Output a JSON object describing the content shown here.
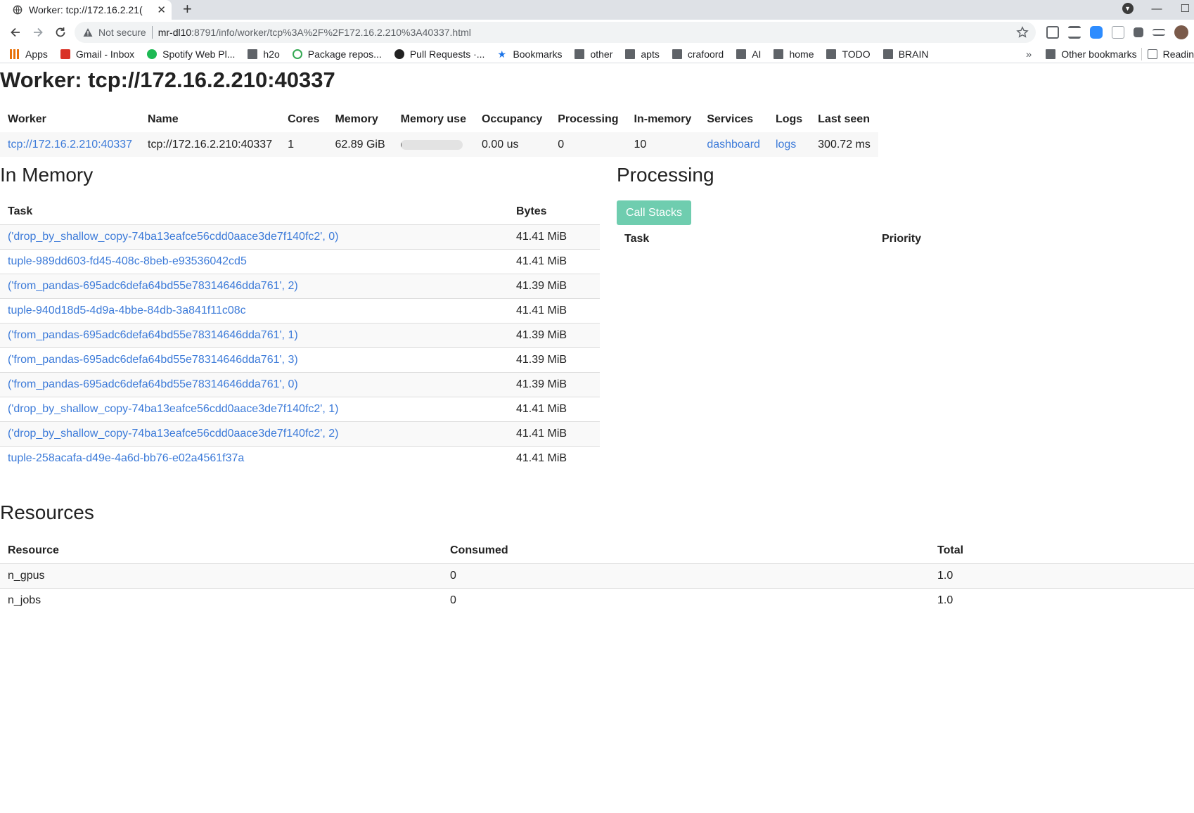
{
  "browser": {
    "tab_title": "Worker: tcp://172.16.2.21(",
    "url_security": "Not secure",
    "url_host": "mr-dl10",
    "url_path": ":8791/info/worker/tcp%3A%2F%2F172.16.2.210%3A40337.html",
    "bookmarks": [
      {
        "label": "Apps",
        "icon": "apps-grid-icon"
      },
      {
        "label": "Gmail - Inbox",
        "icon": "gmail-icon"
      },
      {
        "label": "Spotify Web Pl...",
        "icon": "spotify-icon"
      },
      {
        "label": "h2o",
        "icon": "folder-icon"
      },
      {
        "label": "Package repos...",
        "icon": "loading-ring-icon"
      },
      {
        "label": "Pull Requests ·...",
        "icon": "github-icon"
      },
      {
        "label": "Bookmarks",
        "icon": "star-icon"
      },
      {
        "label": "other",
        "icon": "folder-icon"
      },
      {
        "label": "apts",
        "icon": "folder-icon"
      },
      {
        "label": "crafoord",
        "icon": "folder-icon"
      },
      {
        "label": "AI",
        "icon": "folder-icon"
      },
      {
        "label": "home",
        "icon": "folder-icon"
      },
      {
        "label": "TODO",
        "icon": "folder-icon"
      },
      {
        "label": "BRAIN",
        "icon": "folder-icon"
      }
    ],
    "overflow": "»",
    "other_bookmarks": "Other bookmarks",
    "reading_list": "Readin"
  },
  "page": {
    "title": "Worker: tcp://172.16.2.210:40337"
  },
  "worker_table": {
    "headers": [
      "Worker",
      "Name",
      "Cores",
      "Memory",
      "Memory use",
      "Occupancy",
      "Processing",
      "In-memory",
      "Services",
      "Logs",
      "Last seen"
    ],
    "row": {
      "worker": "tcp://172.16.2.210:40337",
      "name": "tcp://172.16.2.210:40337",
      "cores": "1",
      "memory": "62.89 GiB",
      "memory_use_fraction": 0.02,
      "occupancy": "0.00 us",
      "processing": "0",
      "in_memory": "10",
      "services": "dashboard",
      "logs": "logs",
      "last_seen": "300.72 ms"
    }
  },
  "in_memory": {
    "heading": "In Memory",
    "headers": [
      "Task",
      "Bytes"
    ],
    "rows": [
      {
        "task": "('drop_by_shallow_copy-74ba13eafce56cdd0aace3de7f140fc2', 0)",
        "bytes": "41.41 MiB"
      },
      {
        "task": "tuple-989dd603-fd45-408c-8beb-e93536042cd5",
        "bytes": "41.41 MiB"
      },
      {
        "task": "('from_pandas-695adc6defa64bd55e78314646dda761', 2)",
        "bytes": "41.39 MiB"
      },
      {
        "task": "tuple-940d18d5-4d9a-4bbe-84db-3a841f11c08c",
        "bytes": "41.41 MiB"
      },
      {
        "task": "('from_pandas-695adc6defa64bd55e78314646dda761', 1)",
        "bytes": "41.39 MiB"
      },
      {
        "task": "('from_pandas-695adc6defa64bd55e78314646dda761', 3)",
        "bytes": "41.39 MiB"
      },
      {
        "task": "('from_pandas-695adc6defa64bd55e78314646dda761', 0)",
        "bytes": "41.39 MiB"
      },
      {
        "task": "('drop_by_shallow_copy-74ba13eafce56cdd0aace3de7f140fc2', 1)",
        "bytes": "41.41 MiB"
      },
      {
        "task": "('drop_by_shallow_copy-74ba13eafce56cdd0aace3de7f140fc2', 2)",
        "bytes": "41.41 MiB"
      },
      {
        "task": "tuple-258acafa-d49e-4a6d-bb76-e02a4561f37a",
        "bytes": "41.41 MiB"
      }
    ]
  },
  "processing": {
    "heading": "Processing",
    "button": "Call Stacks",
    "headers": [
      "Task",
      "Priority"
    ]
  },
  "resources": {
    "heading": "Resources",
    "headers": [
      "Resource",
      "Consumed",
      "Total"
    ],
    "rows": [
      {
        "resource": "n_gpus",
        "consumed": "0",
        "total": "1.0"
      },
      {
        "resource": "n_jobs",
        "consumed": "0",
        "total": "1.0"
      }
    ]
  },
  "colors": {
    "link": "#3d7bd9",
    "button_bg": "#6fcdaf"
  }
}
